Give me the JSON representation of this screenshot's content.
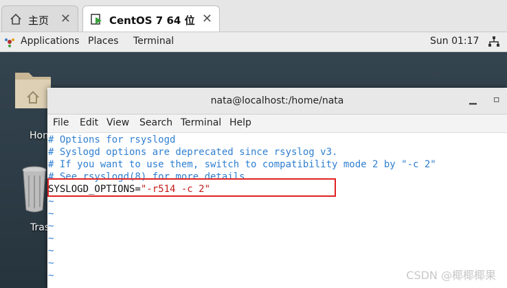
{
  "vm_tabs": [
    {
      "label": "主页",
      "icon": "home-icon"
    },
    {
      "label": "CentOS 7 64 位",
      "icon": "vm-play-icon"
    }
  ],
  "topbar": {
    "applications": "Applications",
    "places": "Places",
    "terminal": "Terminal",
    "clock": "Sun 01:17"
  },
  "desktop": {
    "home_label": "Hon",
    "trash_label": "Tras"
  },
  "terminal": {
    "title": "nata@localhost:/home/nata",
    "menu": [
      "File",
      "Edit",
      "View",
      "Search",
      "Terminal",
      "Help"
    ],
    "lines": [
      {
        "type": "comment",
        "text": "# Options for rsyslogd"
      },
      {
        "type": "comment",
        "text": "# Syslogd options are deprecated since rsyslog v3."
      },
      {
        "type": "comment",
        "text": "# If you want to use them, switch to compatibility mode 2 by \"-c 2\""
      },
      {
        "type": "comment",
        "text": "# See rsyslogd(8) for more details"
      }
    ],
    "option_var": "SYSLOGD_OPTIONS=",
    "option_value": "\"-r514 -c 2\"",
    "tilde": "~",
    "tilde_count": 7
  },
  "watermark": "CSDN @椰椰椰果",
  "colors": {
    "comment": "#2f7fd0",
    "string": "#c41a16",
    "highlight_box": "#e02020"
  }
}
